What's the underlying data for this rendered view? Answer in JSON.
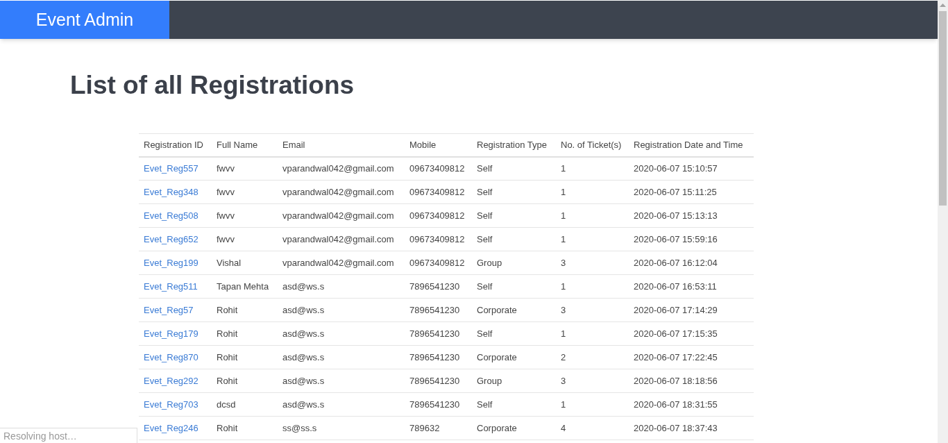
{
  "navbar": {
    "brand": "Event Admin"
  },
  "title": "List of all Registrations",
  "table": {
    "columns": [
      "Registration ID",
      "Full Name",
      "Email",
      "Mobile",
      "Registration Type",
      "No. of Ticket(s)",
      "Registration Date and Time"
    ],
    "rows": [
      [
        "Evet_Reg557",
        "fwvv",
        "vparandwal042@gmail.com",
        "09673409812",
        "Self",
        "1",
        "2020-06-07 15:10:57"
      ],
      [
        "Evet_Reg348",
        "fwvv",
        "vparandwal042@gmail.com",
        "09673409812",
        "Self",
        "1",
        "2020-06-07 15:11:25"
      ],
      [
        "Evet_Reg508",
        "fwvv",
        "vparandwal042@gmail.com",
        "09673409812",
        "Self",
        "1",
        "2020-06-07 15:13:13"
      ],
      [
        "Evet_Reg652",
        "fwvv",
        "vparandwal042@gmail.com",
        "09673409812",
        "Self",
        "1",
        "2020-06-07 15:59:16"
      ],
      [
        "Evet_Reg199",
        "Vishal",
        "vparandwal042@gmail.com",
        "09673409812",
        "Group",
        "3",
        "2020-06-07 16:12:04"
      ],
      [
        "Evet_Reg511",
        "Tapan Mehta",
        "asd@ws.s",
        "7896541230",
        "Self",
        "1",
        "2020-06-07 16:53:11"
      ],
      [
        "Evet_Reg57",
        "Rohit",
        "asd@ws.s",
        "7896541230",
        "Corporate",
        "3",
        "2020-06-07 17:14:29"
      ],
      [
        "Evet_Reg179",
        "Rohit",
        "asd@ws.s",
        "7896541230",
        "Self",
        "1",
        "2020-06-07 17:15:35"
      ],
      [
        "Evet_Reg870",
        "Rohit",
        "asd@ws.s",
        "7896541230",
        "Corporate",
        "2",
        "2020-06-07 17:22:45"
      ],
      [
        "Evet_Reg292",
        "Rohit",
        "asd@ws.s",
        "7896541230",
        "Group",
        "3",
        "2020-06-07 18:18:56"
      ],
      [
        "Evet_Reg703",
        "dcsd",
        "asd@ws.s",
        "7896541230",
        "Self",
        "1",
        "2020-06-07 18:31:55"
      ],
      [
        "Evet_Reg246",
        "Rohit",
        "ss@ss.s",
        "789632",
        "Corporate",
        "4",
        "2020-06-07 18:37:43"
      ]
    ]
  },
  "status_bar": {
    "text": "Resolving host…"
  }
}
